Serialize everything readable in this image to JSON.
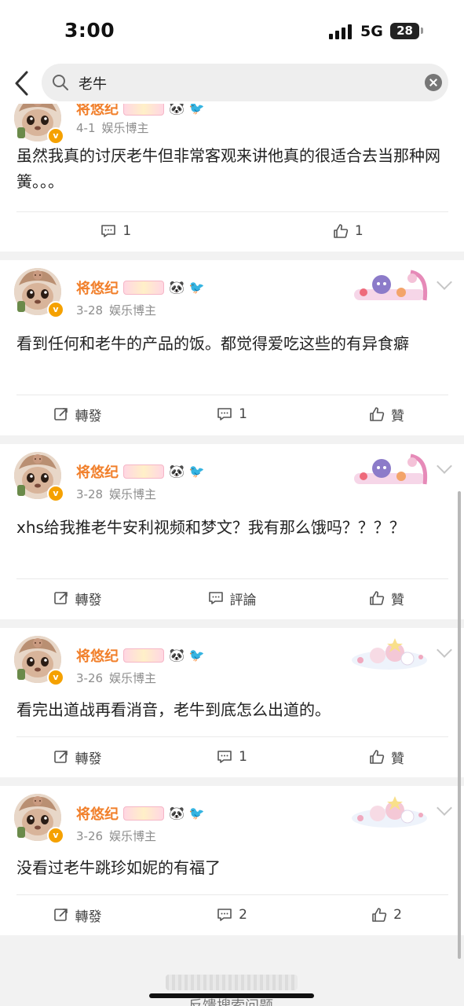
{
  "status_bar": {
    "time": "3:00",
    "network": "5G",
    "battery": "28"
  },
  "search": {
    "query": "老牛"
  },
  "colors": {
    "name": "#f17f2a",
    "vip_badge": "#f5a100"
  },
  "posts": [
    {
      "name": "将悠纪",
      "date": "4-1",
      "source": "娱乐博主",
      "text": "虽然我真的讨厌老牛但非常客观来讲他真的很适合去当那种网簧。。。",
      "actions": [
        {
          "icon": "comment-icon",
          "label": "1"
        },
        {
          "icon": "like-icon",
          "label": "1"
        }
      ]
    },
    {
      "name": "将悠纪",
      "date": "3-28",
      "source": "娱乐博主",
      "text": "看到任何和老牛的产品的饭。都觉得爱吃这些的有异食癖",
      "actions": [
        {
          "icon": "repost-icon",
          "label": "轉發"
        },
        {
          "icon": "comment-icon",
          "label": "1"
        },
        {
          "icon": "like-icon",
          "label": "贊"
        }
      ]
    },
    {
      "name": "将悠纪",
      "date": "3-28",
      "source": "娱乐博主",
      "text": "xhs给我推老牛安利视频和梦文？我有那么饿吗？？？？",
      "actions": [
        {
          "icon": "repost-icon",
          "label": "轉發"
        },
        {
          "icon": "comment-icon",
          "label": "評論"
        },
        {
          "icon": "like-icon",
          "label": "贊"
        }
      ]
    },
    {
      "name": "将悠纪",
      "date": "3-26",
      "source": "娱乐博主",
      "text": "看完出道战再看消音，老牛到底怎么出道的。",
      "actions": [
        {
          "icon": "repost-icon",
          "label": "轉發"
        },
        {
          "icon": "comment-icon",
          "label": "1"
        },
        {
          "icon": "like-icon",
          "label": "贊"
        }
      ]
    },
    {
      "name": "将悠纪",
      "date": "3-26",
      "source": "娱乐博主",
      "text": "没看过老牛跳珍如妮的有福了",
      "actions": [
        {
          "icon": "repost-icon",
          "label": "轉發"
        },
        {
          "icon": "comment-icon",
          "label": "2"
        },
        {
          "icon": "like-icon",
          "label": "2"
        }
      ]
    }
  ],
  "footer": {
    "partial_text": "反馈搜索问题"
  }
}
